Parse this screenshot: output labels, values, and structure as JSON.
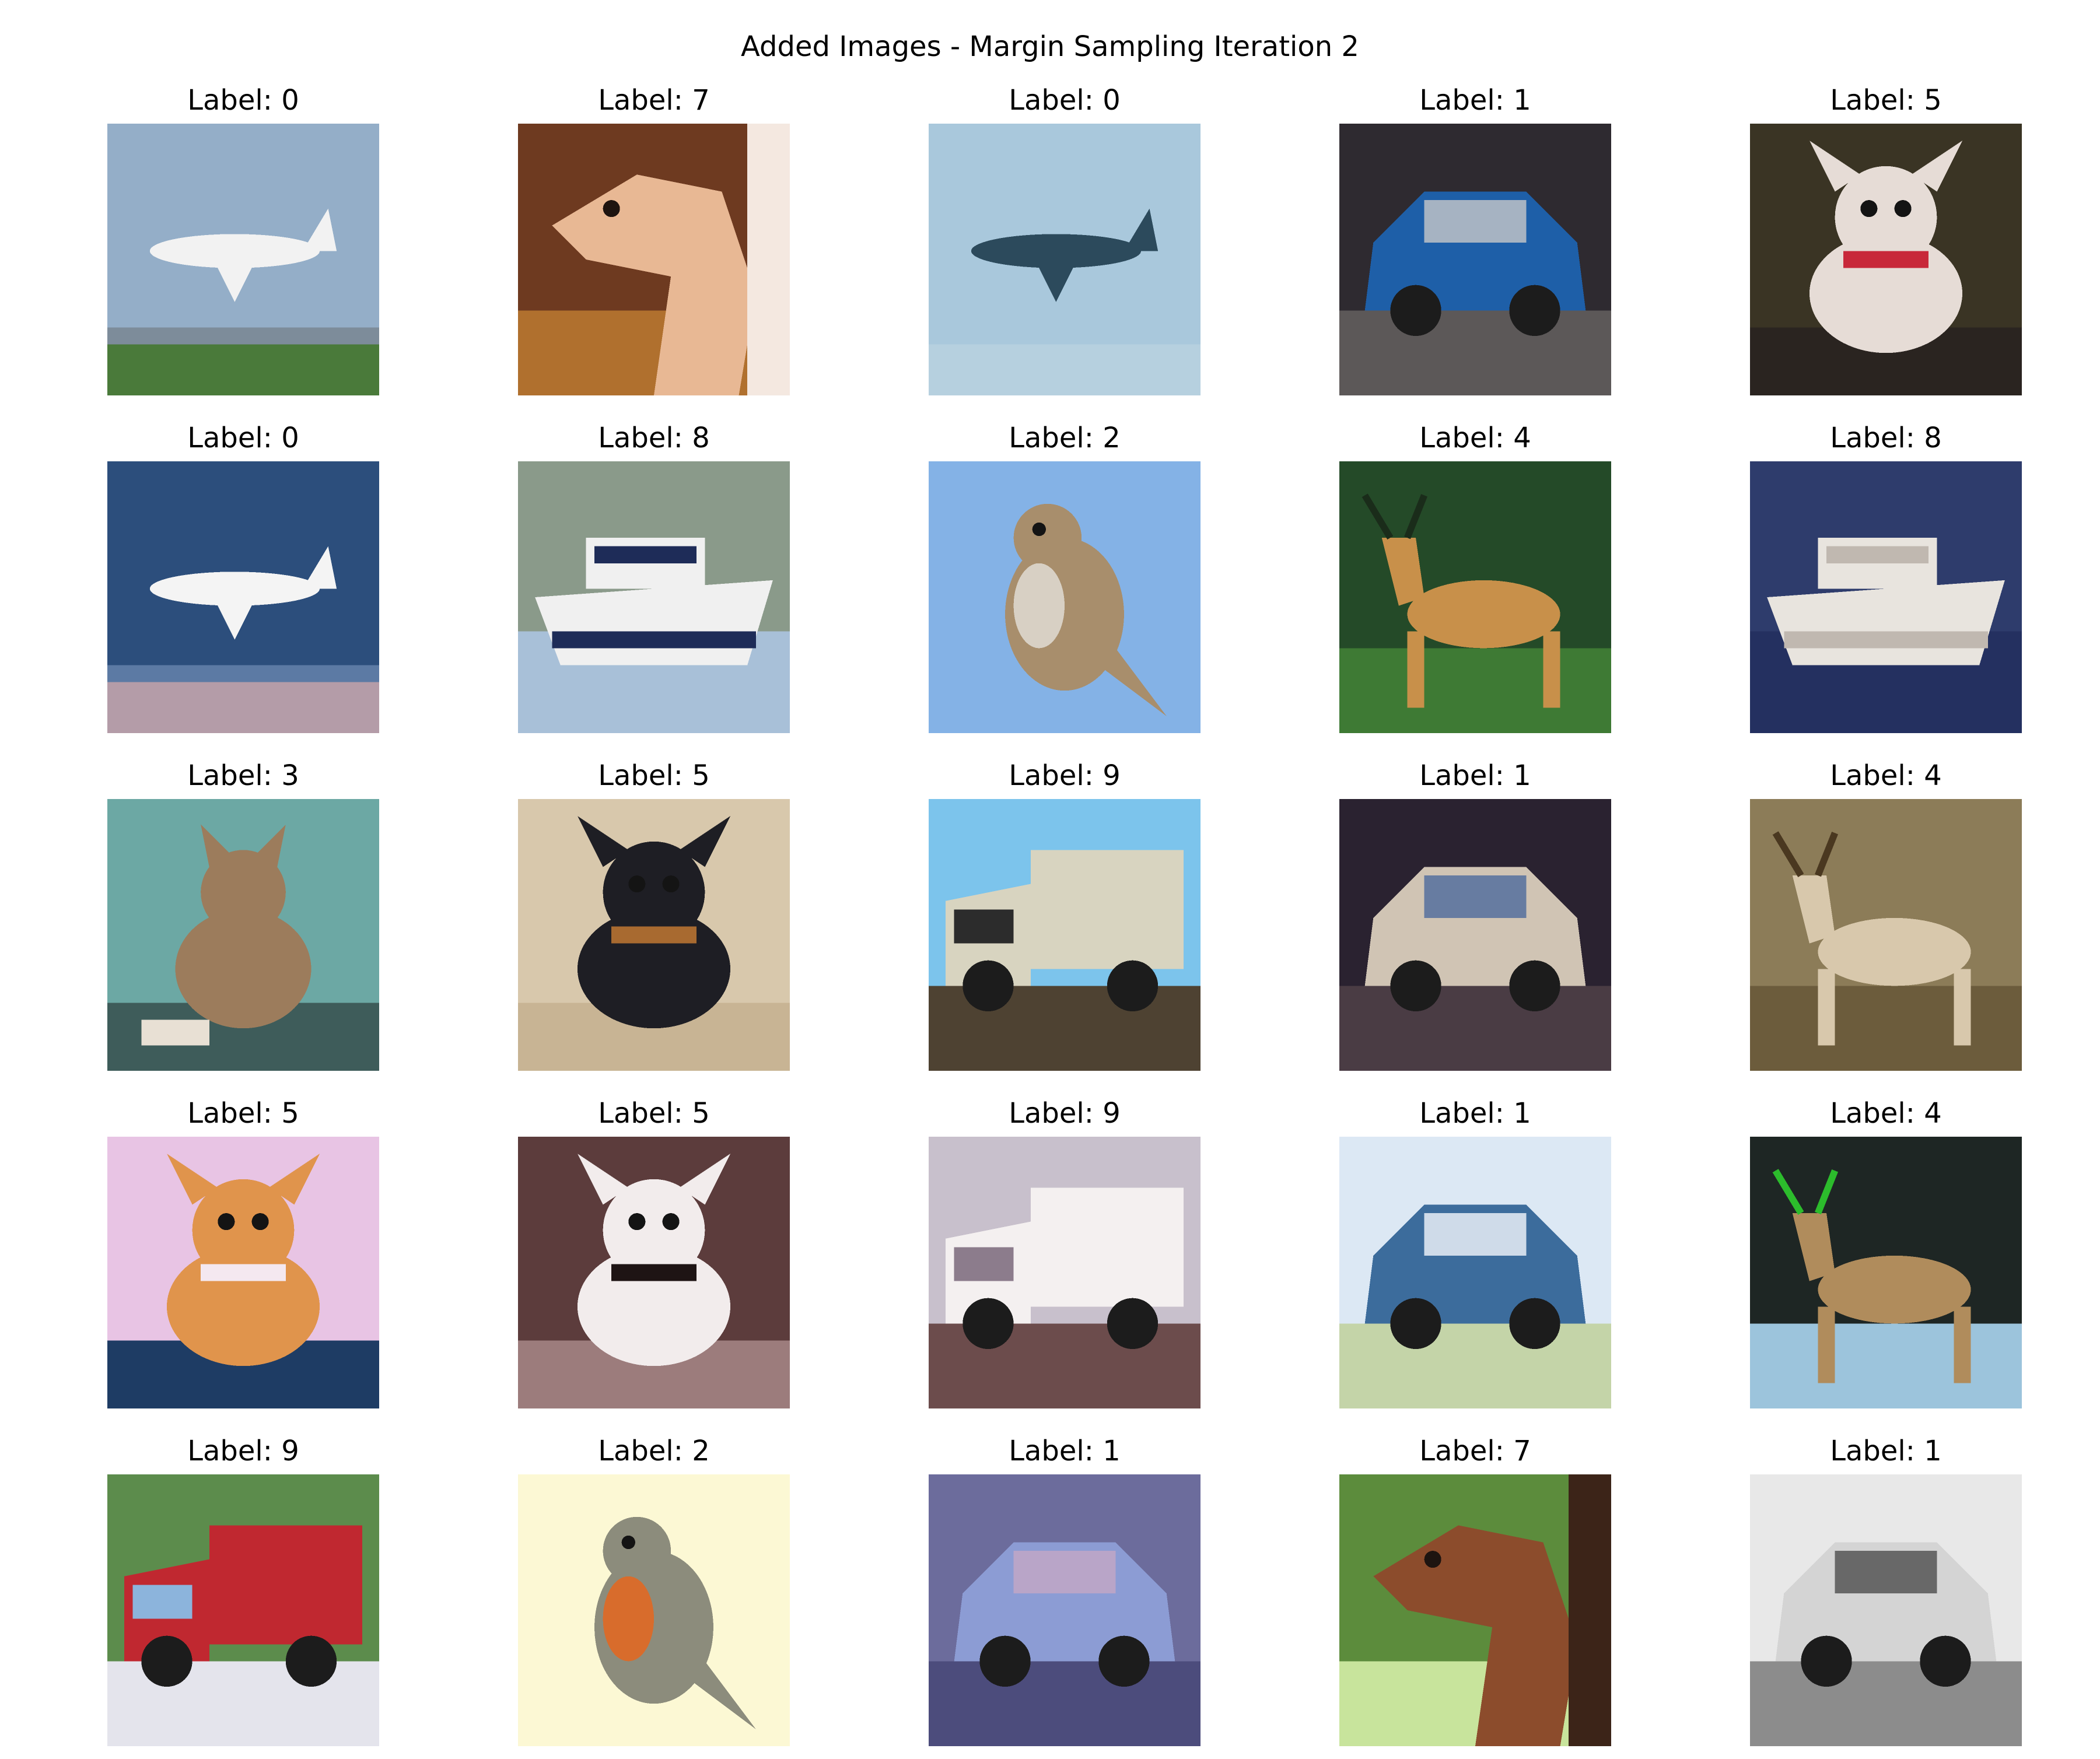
{
  "title": "Added Images - Margin Sampling Iteration 2",
  "label_prefix": "Label: ",
  "images": [
    {
      "label": 0,
      "subject": "airplane",
      "bg": "#94aec8",
      "ground": "#4a7a3a",
      "fg": "#f2f2f2",
      "accent": "#7d8c9a"
    },
    {
      "label": 7,
      "subject": "horse",
      "bg": "#6e3a20",
      "ground": "#b0702e",
      "fg": "#e8b894",
      "accent": "#f4e8e0"
    },
    {
      "label": 0,
      "subject": "airplane",
      "bg": "#a9c8dc",
      "ground": "#b6d0df",
      "fg": "#2c4a5c",
      "accent": "#a9c8dc"
    },
    {
      "label": 1,
      "subject": "automobile",
      "bg": "#2e2a30",
      "ground": "#5c5858",
      "fg": "#1e5fa8",
      "accent": "#c8c8c8"
    },
    {
      "label": 5,
      "subject": "dog",
      "bg": "#3a3424",
      "ground": "#2a2420",
      "fg": "#e6dcd6",
      "accent": "#c8283a"
    },
    {
      "label": 0,
      "subject": "airplane",
      "bg": "#2c4e7c",
      "ground": "#b49ca8",
      "fg": "#f4f4f4",
      "accent": "#5c7aa4"
    },
    {
      "label": 8,
      "subject": "ship",
      "bg": "#8a9a8a",
      "ground": "#a8c0d8",
      "fg": "#f0f0f0",
      "accent": "#1e2c58"
    },
    {
      "label": 2,
      "subject": "bird",
      "bg": "#84b2e6",
      "ground": "#84b2e6",
      "fg": "#a88e6c",
      "accent": "#d8d0c4"
    },
    {
      "label": 4,
      "subject": "deer",
      "bg": "#244a28",
      "ground": "#3e7a34",
      "fg": "#c8904a",
      "accent": "#1a2c1a"
    },
    {
      "label": 8,
      "subject": "ship",
      "bg": "#2e3c6c",
      "ground": "#243060",
      "fg": "#e8e4de",
      "accent": "#c0b8b0"
    },
    {
      "label": 3,
      "subject": "cat",
      "bg": "#6ca8a4",
      "ground": "#3e5c5a",
      "fg": "#9c7c5c",
      "accent": "#e8e0d4"
    },
    {
      "label": 5,
      "subject": "dog",
      "bg": "#d8c8ac",
      "ground": "#c8b494",
      "fg": "#1e1e24",
      "accent": "#a86a30"
    },
    {
      "label": 9,
      "subject": "truck",
      "bg": "#7cc4ec",
      "ground": "#4e4232",
      "fg": "#d8d4c0",
      "accent": "#2c2c2c"
    },
    {
      "label": 1,
      "subject": "automobile",
      "bg": "#2a2230",
      "ground": "#4a3c44",
      "fg": "#d0c4b4",
      "accent": "#4c6a9c"
    },
    {
      "label": 4,
      "subject": "deer",
      "bg": "#8c7c58",
      "ground": "#6c5c3c",
      "fg": "#d8c8ac",
      "accent": "#4a3820"
    },
    {
      "label": 5,
      "subject": "dog",
      "bg": "#e8c4e4",
      "ground": "#1e3c64",
      "fg": "#e0944c",
      "accent": "#f4e8f0"
    },
    {
      "label": 5,
      "subject": "dog",
      "bg": "#5c3c3c",
      "ground": "#9c7c7c",
      "fg": "#f2ecec",
      "accent": "#1e1414"
    },
    {
      "label": 9,
      "subject": "truck",
      "bg": "#c8c0cc",
      "ground": "#6c4c4c",
      "fg": "#f4f0f0",
      "accent": "#8c7c8c"
    },
    {
      "label": 1,
      "subject": "automobile",
      "bg": "#dce8f4",
      "ground": "#c4d4a8",
      "fg": "#3c6c9c",
      "accent": "#f4f8fc"
    },
    {
      "label": 4,
      "subject": "deer",
      "bg": "#1e2624",
      "ground": "#9cc4dc",
      "fg": "#b08c5c",
      "accent": "#2cbc2c"
    },
    {
      "label": 9,
      "subject": "truck",
      "bg": "#5c8c4c",
      "ground": "#e4e4ec",
      "fg": "#c02830",
      "accent": "#8cb4dc"
    },
    {
      "label": 2,
      "subject": "bird",
      "bg": "#fcf8d4",
      "ground": "#fcf8d4",
      "fg": "#8c8c7c",
      "accent": "#d86c2c"
    },
    {
      "label": 1,
      "subject": "automobile",
      "bg": "#6c6c9c",
      "ground": "#4c4c7c",
      "fg": "#8c9cd4",
      "accent": "#c4a8c4"
    },
    {
      "label": 7,
      "subject": "horse",
      "bg": "#5c8c3c",
      "ground": "#c8e49c",
      "fg": "#8c4c2c",
      "accent": "#3c2418"
    },
    {
      "label": 1,
      "subject": "automobile",
      "bg": "#e8e8e8",
      "ground": "#8c8c8c",
      "fg": "#d4d4d4",
      "accent": "#4c4c4c"
    }
  ]
}
